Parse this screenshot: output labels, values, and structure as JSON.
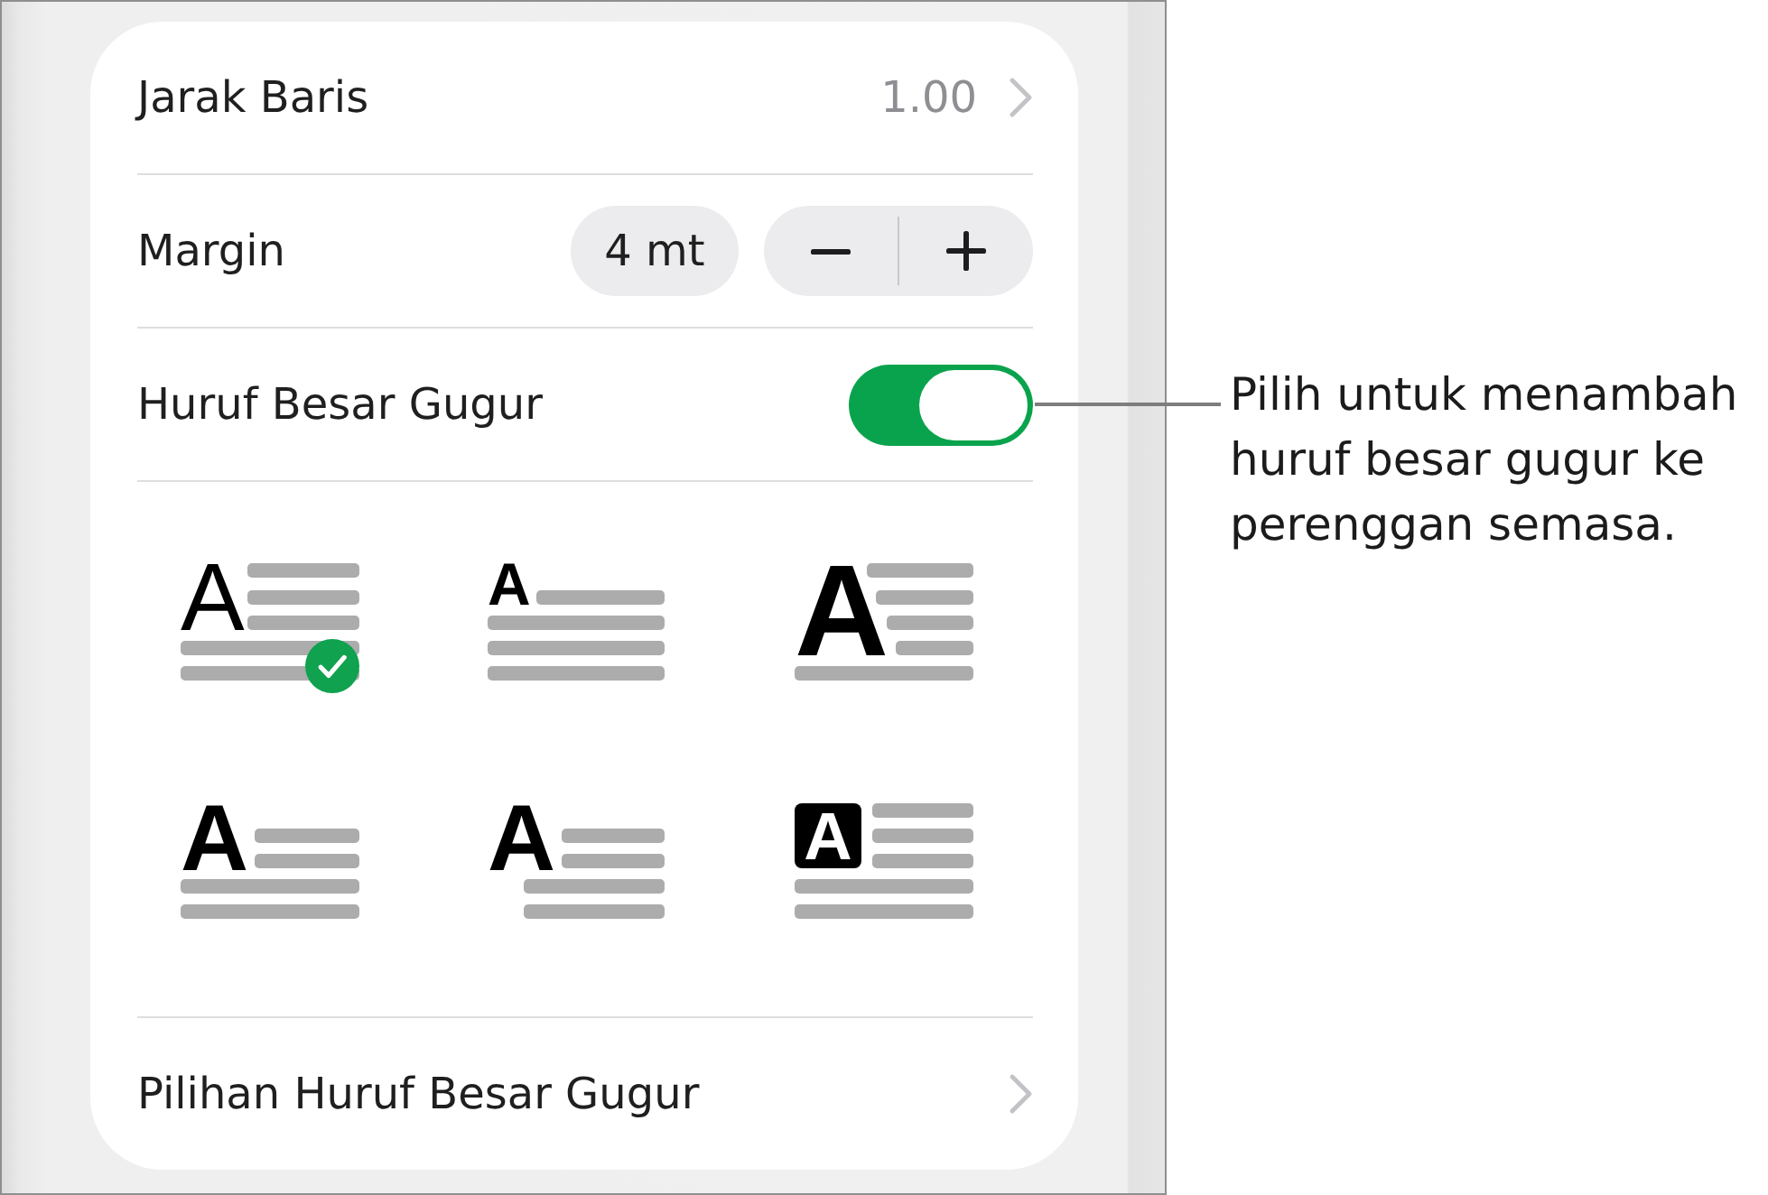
{
  "panel": {
    "rows": [
      {
        "kind": "value",
        "label": "Jarak Baris",
        "value": "1.00"
      },
      {
        "kind": "stepper",
        "label": "Margin",
        "value": "4 mt"
      },
      {
        "kind": "toggle",
        "label": "Huruf Besar Gugur",
        "on": true
      }
    ],
    "styles": [
      {
        "kind": "plain",
        "glyph": "A",
        "selected": true
      },
      {
        "kind": "raised",
        "glyph": "A",
        "selected": false
      },
      {
        "kind": "stepped",
        "glyph": "A",
        "selected": false
      },
      {
        "kind": "dropped",
        "glyph": "A",
        "selected": false
      },
      {
        "kind": "margin",
        "glyph": "A",
        "selected": false
      },
      {
        "kind": "boxed",
        "glyph": "A",
        "selected": false
      }
    ],
    "footer": {
      "label": "Pilihan Huruf Besar Gugur"
    }
  },
  "callout": {
    "text": "Pilih untuk menambah huruf besar gugur ke perenggan semasa."
  }
}
